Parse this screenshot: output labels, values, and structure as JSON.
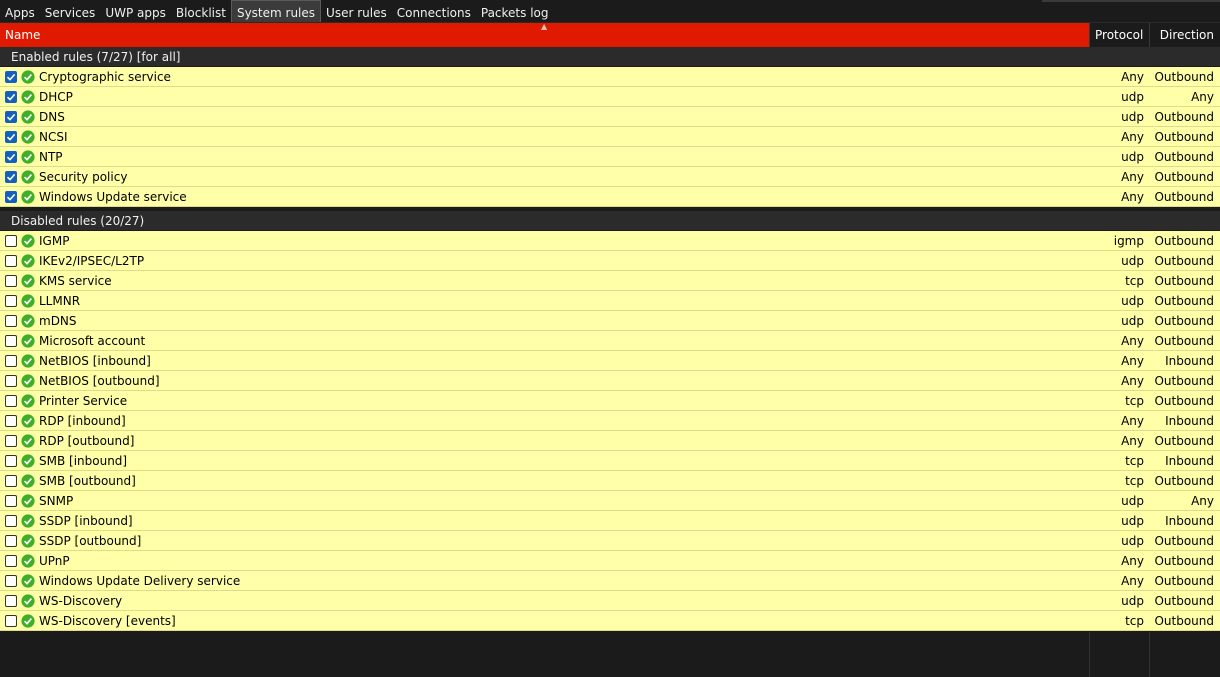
{
  "tabs": [
    "Apps",
    "Services",
    "UWP apps",
    "Blocklist",
    "System rules",
    "User rules",
    "Connections",
    "Packets log"
  ],
  "active_tab": "System rules",
  "columns": {
    "name": "Name",
    "protocol": "Protocol",
    "direction": "Direction"
  },
  "groups": [
    {
      "title": "Enabled rules (7/27) [for all]",
      "rows": [
        {
          "name": "Cryptographic service",
          "protocol": "Any",
          "direction": "Outbound",
          "checked": true
        },
        {
          "name": "DHCP",
          "protocol": "udp",
          "direction": "Any",
          "checked": true
        },
        {
          "name": "DNS",
          "protocol": "udp",
          "direction": "Outbound",
          "checked": true
        },
        {
          "name": "NCSI",
          "protocol": "Any",
          "direction": "Outbound",
          "checked": true
        },
        {
          "name": "NTP",
          "protocol": "udp",
          "direction": "Outbound",
          "checked": true
        },
        {
          "name": "Security policy",
          "protocol": "Any",
          "direction": "Outbound",
          "checked": true
        },
        {
          "name": "Windows Update service",
          "protocol": "Any",
          "direction": "Outbound",
          "checked": true
        }
      ]
    },
    {
      "title": "Disabled rules (20/27)",
      "rows": [
        {
          "name": "IGMP",
          "protocol": "igmp",
          "direction": "Outbound",
          "checked": false
        },
        {
          "name": "IKEv2/IPSEC/L2TP",
          "protocol": "udp",
          "direction": "Outbound",
          "checked": false
        },
        {
          "name": "KMS service",
          "protocol": "tcp",
          "direction": "Outbound",
          "checked": false
        },
        {
          "name": "LLMNR",
          "protocol": "udp",
          "direction": "Outbound",
          "checked": false
        },
        {
          "name": "mDNS",
          "protocol": "udp",
          "direction": "Outbound",
          "checked": false
        },
        {
          "name": "Microsoft account",
          "protocol": "Any",
          "direction": "Outbound",
          "checked": false
        },
        {
          "name": "NetBIOS [inbound]",
          "protocol": "Any",
          "direction": "Inbound",
          "checked": false
        },
        {
          "name": "NetBIOS [outbound]",
          "protocol": "Any",
          "direction": "Outbound",
          "checked": false
        },
        {
          "name": "Printer Service",
          "protocol": "tcp",
          "direction": "Outbound",
          "checked": false
        },
        {
          "name": "RDP [inbound]",
          "protocol": "Any",
          "direction": "Inbound",
          "checked": false
        },
        {
          "name": "RDP [outbound]",
          "protocol": "Any",
          "direction": "Outbound",
          "checked": false
        },
        {
          "name": "SMB [inbound]",
          "protocol": "tcp",
          "direction": "Inbound",
          "checked": false
        },
        {
          "name": "SMB [outbound]",
          "protocol": "tcp",
          "direction": "Outbound",
          "checked": false
        },
        {
          "name": "SNMP",
          "protocol": "udp",
          "direction": "Any",
          "checked": false
        },
        {
          "name": "SSDP [inbound]",
          "protocol": "udp",
          "direction": "Inbound",
          "checked": false
        },
        {
          "name": "SSDP [outbound]",
          "protocol": "udp",
          "direction": "Outbound",
          "checked": false
        },
        {
          "name": "UPnP",
          "protocol": "Any",
          "direction": "Outbound",
          "checked": false
        },
        {
          "name": "Windows Update Delivery service",
          "protocol": "Any",
          "direction": "Outbound",
          "checked": false
        },
        {
          "name": "WS-Discovery",
          "protocol": "udp",
          "direction": "Outbound",
          "checked": false
        },
        {
          "name": "WS-Discovery [events]",
          "protocol": "tcp",
          "direction": "Outbound",
          "checked": false
        }
      ]
    }
  ],
  "icons": {
    "rule_status": "green-check-circle-icon",
    "sort": "sort-ascending-icon"
  },
  "colors": {
    "header_accent": "#e01a00",
    "row_bg": "#ffffa8",
    "checkbox_on": "#1560bd",
    "ok_icon": "#3fae29"
  }
}
